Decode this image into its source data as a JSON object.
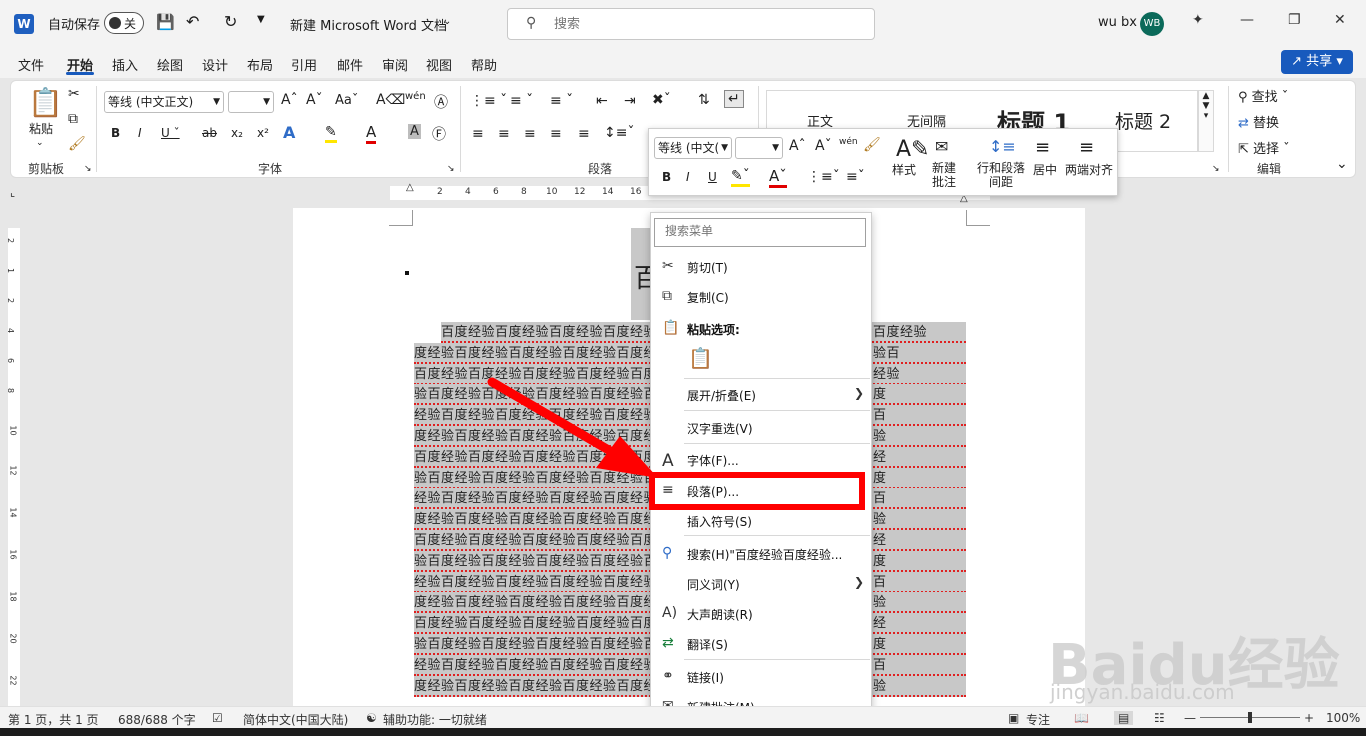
{
  "titlebar": {
    "autosave_label": "自动保存",
    "autosave_state": "关",
    "doc_title": "新建 Microsoft Word 文档",
    "search_placeholder": "搜索",
    "user_name": "wu bx",
    "user_initials": "WB"
  },
  "tabs": [
    "文件",
    "开始",
    "插入",
    "绘图",
    "设计",
    "布局",
    "引用",
    "邮件",
    "审阅",
    "视图",
    "帮助"
  ],
  "active_tab": "开始",
  "share_label": "共享",
  "ribbon": {
    "clipboard": {
      "paste": "粘贴",
      "label": "剪贴板"
    },
    "font": {
      "name": "等线 (中文正文)",
      "size": "",
      "label": "字体"
    },
    "paragraph": {
      "label": "段落"
    },
    "styles": [
      "正文",
      "无间隔",
      "标题 1",
      "标题 2"
    ],
    "editing": {
      "find": "查找",
      "replace": "替换",
      "select": "选择",
      "label": "编辑"
    }
  },
  "ruler_numbers": [
    "2",
    "4",
    "6",
    "8",
    "10",
    "12",
    "14",
    "16"
  ],
  "vruler_numbers": [
    "2",
    "1",
    "2",
    "4",
    "6",
    "8",
    "10",
    "12",
    "14",
    "16",
    "18",
    "20",
    "22"
  ],
  "mini_toolbar": {
    "font_name": "等线 (中文(",
    "font_size": "",
    "styles": "样式",
    "new_comment": "新建批注",
    "line_spacing": "行和段落间距",
    "center": "居中",
    "justify": "两端对齐"
  },
  "document": {
    "title_char": "百",
    "lines": [
      "百度经验百度经验百度经验百度经验百度经验百度经验百度经验百度经验百度经验",
      "度经验百度经验百度经验百度经验百度经验百度经验百度经验百度经验百度经验百",
      "百度经验百度经验百度经验百度经验百度经验百度经验百度经验百度经验百度经验",
      "验百度经验百度经验百度经验百度经验百度经验百度经验百度经验百度经验百度",
      "经验百度经验百度经验百度经验百度经验百度经验百度经验百度经验百度经验百",
      "度经验百度经验百度经验百度经验百度经验百度经验百度经验百度经验百度经验",
      "百度经验百度经验百度经验百度经验百度经验百度经验百度经验百度经验百度经",
      "验百度经验百度经验百度经验百度经验百度经验百度经验百度经验百度经验百度",
      "经验百度经验百度经验百度经验百度经验百度经验百度经验百度经验百度经验百",
      "度经验百度经验百度经验百度经验百度经验百度经验百度经验百度经验百度经验",
      "百度经验百度经验百度经验百度经验百度经验百度经验百度经验百度经验百度经",
      "验百度经验百度经验百度经验百度经验百度经验百度经验百度经验百度经验百度",
      "经验百度经验百度经验百度经验百度经验百度经验百度经验百度经验百度经验百",
      "度经验百度经验百度经验百度经验百度经验百度经验百度经验百度经验百度经验",
      "百度经验百度经验百度经验百度经验百度经验百度经验百度经验百度经验百度经",
      "验百度经验百度经验百度经验百度经验百度经验百度经验百度经验百度经验百度",
      "经验百度经验百度经验百度经验百度经验百度经验百度经验百度经验百度经验百",
      "度经验百度经验百度经验百度经验百度经验百度经验百度经验百度经验百度经验"
    ]
  },
  "context_menu": {
    "search_placeholder": "搜索菜单",
    "cut": "剪切(T)",
    "copy": "复制(C)",
    "paste_options": "粘贴选项:",
    "expand_collapse": "展开/折叠(E)",
    "reconvert": "汉字重选(V)",
    "font": "字体(F)...",
    "paragraph": "段落(P)...",
    "insert_symbol": "插入符号(S)",
    "search": "搜索(H)\"百度经验百度经验...",
    "synonyms": "同义词(Y)",
    "read_aloud": "大声朗读(R)",
    "translate": "翻译(S)",
    "link": "链接(I)",
    "new_comment": "新建批注(M)"
  },
  "statusbar": {
    "page": "第 1 页，共 1 页",
    "words": "688/688 个字",
    "language": "简体中文(中国大陆)",
    "accessibility": "辅助功能: 一切就绪",
    "focus": "专注",
    "zoom": "100%"
  },
  "watermark": {
    "brand": "Baidu经验",
    "url": "jingyan.baidu.com"
  },
  "colors": {
    "accent": "#185abd",
    "highlight_box": "#ff0000",
    "arrow": "#ff0000",
    "selection": "#c8c8c8"
  }
}
